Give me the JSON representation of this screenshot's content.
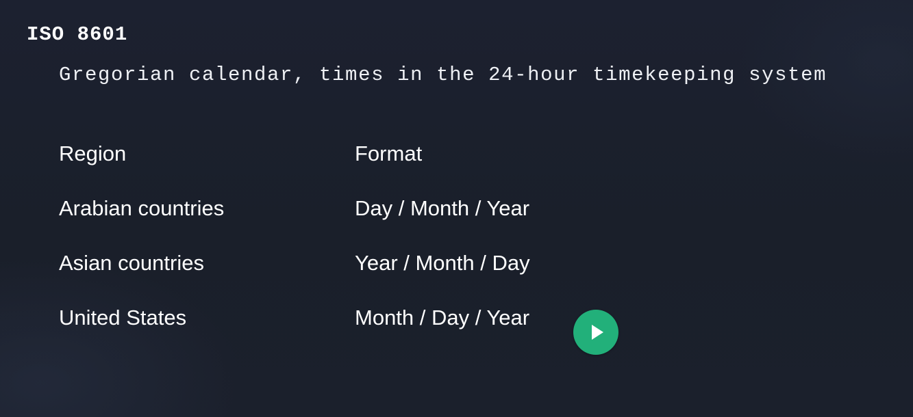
{
  "slide": {
    "title": "ISO 8601",
    "subtitle": "Gregorian calendar, times in the 24-hour timekeeping system"
  },
  "table": {
    "headers": {
      "region": "Region",
      "format": "Format"
    },
    "rows": [
      {
        "region": "Arabian countries",
        "format": "Day / Month / Year"
      },
      {
        "region": "Asian countries",
        "format": "Year / Month / Day"
      },
      {
        "region": "United States",
        "format": "Month / Day / Year"
      }
    ]
  },
  "controls": {
    "play_icon": "play-icon",
    "play_color": "#22b07a"
  },
  "colors": {
    "background": "#1b202b",
    "text": "#ffffff"
  }
}
